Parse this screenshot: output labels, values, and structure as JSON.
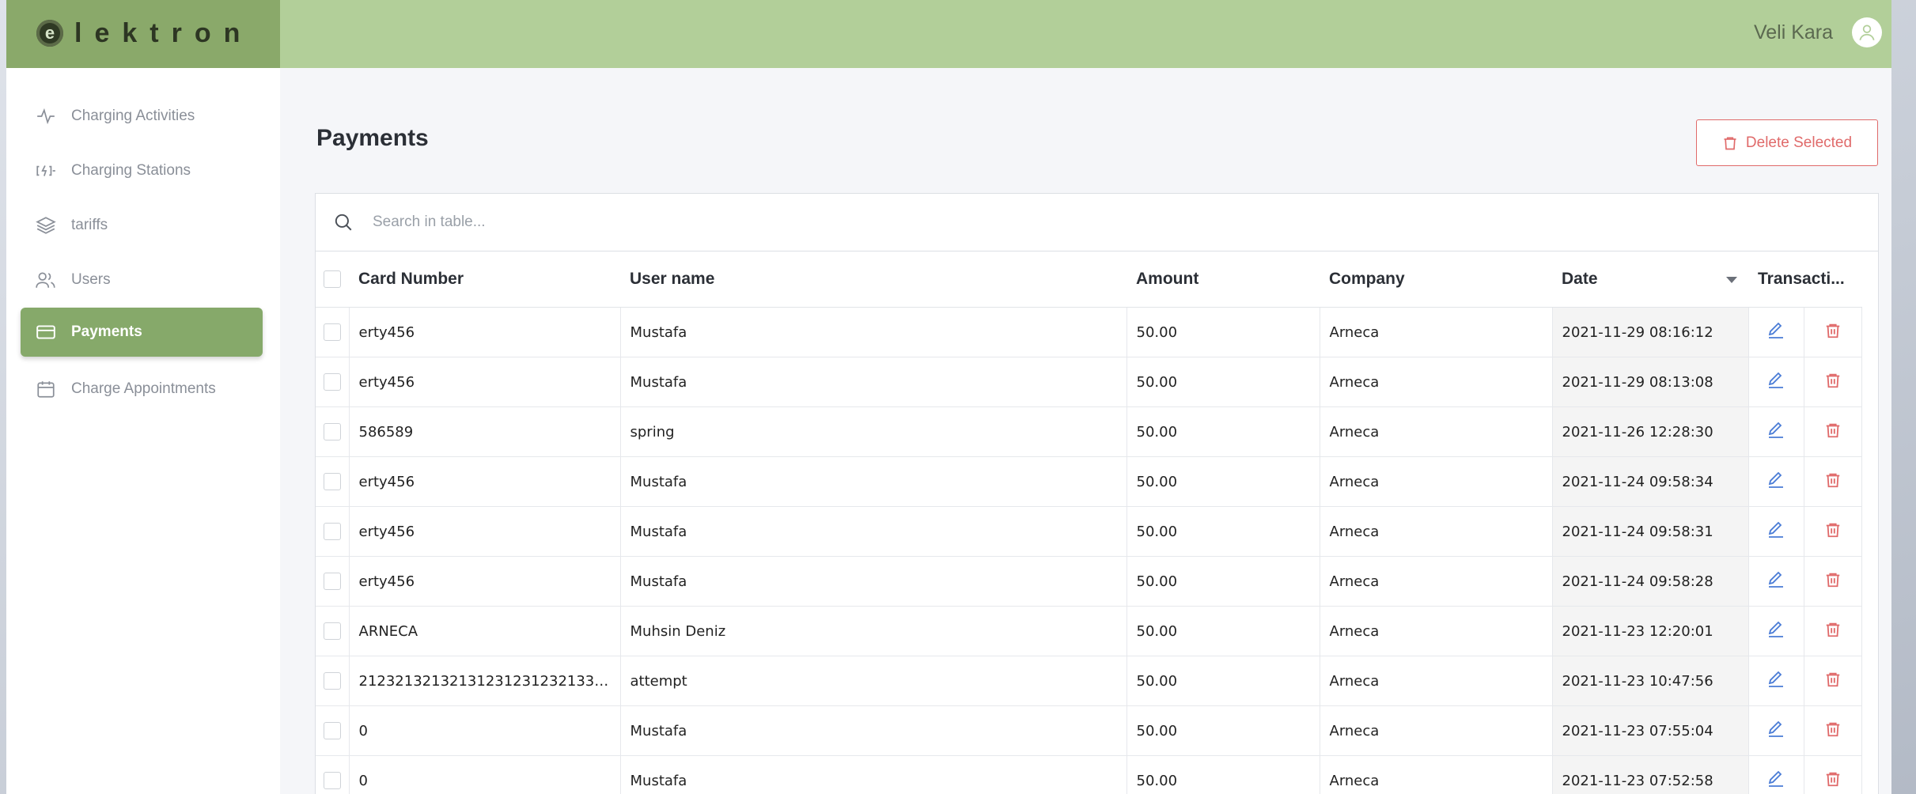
{
  "brand": {
    "logo_letter": "e",
    "logo_text": "lektron"
  },
  "user": {
    "name": "Veli Kara"
  },
  "sidebar": {
    "items": [
      {
        "label": "Charging Activities",
        "icon": "activity-icon",
        "active": false
      },
      {
        "label": "Charging Stations",
        "icon": "charger-icon",
        "active": false
      },
      {
        "label": "tariffs",
        "icon": "layers-icon",
        "active": false
      },
      {
        "label": "Users",
        "icon": "users-icon",
        "active": false
      },
      {
        "label": "Payments",
        "icon": "card-icon",
        "active": true
      },
      {
        "label": "Charge Appointments",
        "icon": "calendar-icon",
        "active": false
      }
    ]
  },
  "page": {
    "title": "Payments",
    "delete_label": "Delete Selected",
    "search_placeholder": "Search in table..."
  },
  "table": {
    "columns": [
      "Card Number",
      "User name",
      "Amount",
      "Company",
      "Date",
      "Transacti..."
    ],
    "sorted_column": "Date",
    "rows": [
      {
        "card": "erty456",
        "user": "Mustafa",
        "amount": "50.00",
        "company": "Arneca",
        "date": "2021-11-29 08:16:12"
      },
      {
        "card": "erty456",
        "user": "Mustafa",
        "amount": "50.00",
        "company": "Arneca",
        "date": "2021-11-29 08:13:08"
      },
      {
        "card": "586589",
        "user": "spring",
        "amount": "50.00",
        "company": "Arneca",
        "date": "2021-11-26 12:28:30"
      },
      {
        "card": "erty456",
        "user": "Mustafa",
        "amount": "50.00",
        "company": "Arneca",
        "date": "2021-11-24 09:58:34"
      },
      {
        "card": "erty456",
        "user": "Mustafa",
        "amount": "50.00",
        "company": "Arneca",
        "date": "2021-11-24 09:58:31"
      },
      {
        "card": "erty456",
        "user": "Mustafa",
        "amount": "50.00",
        "company": "Arneca",
        "date": "2021-11-24 09:58:28"
      },
      {
        "card": "ARNECA",
        "user": "Muhsin Deniz",
        "amount": "50.00",
        "company": "Arneca",
        "date": "2021-11-23 12:20:01"
      },
      {
        "card": "21232132132131231231232133…",
        "user": "attempt",
        "amount": "50.00",
        "company": "Arneca",
        "date": "2021-11-23 10:47:56"
      },
      {
        "card": "0",
        "user": "Mustafa",
        "amount": "50.00",
        "company": "Arneca",
        "date": "2021-11-23 07:55:04"
      },
      {
        "card": "0",
        "user": "Mustafa",
        "amount": "50.00",
        "company": "Arneca",
        "date": "2021-11-23 07:52:58"
      }
    ]
  },
  "colors": {
    "header_bg": "#b2cf99",
    "logo_bg": "#8aa96a",
    "active_nav": "#86a96a",
    "danger": "#e06a6a",
    "edit": "#4a7cd6"
  }
}
